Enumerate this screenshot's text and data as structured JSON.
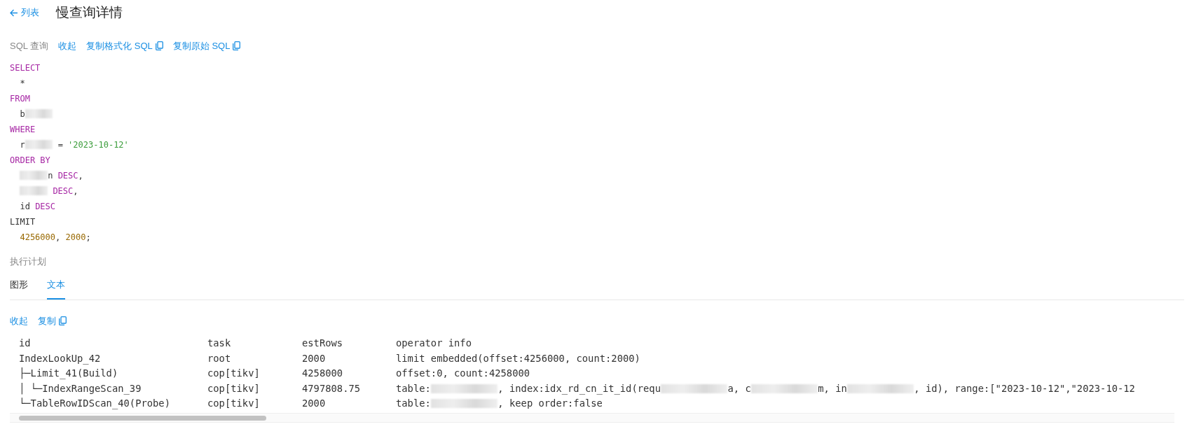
{
  "header": {
    "back_link": "列表",
    "title": "慢查询详情"
  },
  "sql_section": {
    "label": "SQL 查询",
    "actions": [
      {
        "label": "收起",
        "copy": false
      },
      {
        "label": "复制格式化 SQL",
        "copy": true
      },
      {
        "label": "复制原始 SQL",
        "copy": true
      }
    ],
    "lines": [
      [
        {
          "kind": "keyword",
          "text": "SELECT"
        }
      ],
      [
        {
          "kind": "plain",
          "text": "  *"
        }
      ],
      [
        {
          "kind": "keyword",
          "text": "FROM"
        }
      ],
      [
        {
          "kind": "plain",
          "text": "  b"
        },
        {
          "kind": "redacted"
        }
      ],
      [
        {
          "kind": "keyword",
          "text": "WHERE"
        }
      ],
      [
        {
          "kind": "plain",
          "text": "  r"
        },
        {
          "kind": "redacted"
        },
        {
          "kind": "plain",
          "text": " = "
        },
        {
          "kind": "string",
          "text": "'2023-10-12'"
        }
      ],
      [
        {
          "kind": "keyword",
          "text": "ORDER BY"
        }
      ],
      [
        {
          "kind": "indent"
        },
        {
          "kind": "redacted"
        },
        {
          "kind": "plain",
          "text": "n "
        },
        {
          "kind": "keyword",
          "text": "DESC"
        },
        {
          "kind": "plain",
          "text": ","
        }
      ],
      [
        {
          "kind": "indent"
        },
        {
          "kind": "redacted"
        },
        {
          "kind": "keyword",
          "text": " DESC"
        },
        {
          "kind": "plain",
          "text": ","
        }
      ],
      [
        {
          "kind": "plain",
          "text": "  id "
        },
        {
          "kind": "keyword",
          "text": "DESC"
        }
      ],
      [
        {
          "kind": "plain",
          "text": "LIMIT"
        }
      ],
      [
        {
          "kind": "indent"
        },
        {
          "kind": "number",
          "text": "4256000"
        },
        {
          "kind": "plain",
          "text": ", "
        },
        {
          "kind": "number",
          "text": "2000"
        },
        {
          "kind": "plain",
          "text": ";"
        }
      ]
    ]
  },
  "plan_section": {
    "label": "执行计划",
    "tabs": [
      {
        "label": "图形",
        "selected": false
      },
      {
        "label": "文本",
        "selected": true
      }
    ],
    "actions": [
      {
        "label": "收起",
        "copy": false
      },
      {
        "label": "复制",
        "copy": true
      }
    ],
    "columns": [
      "id",
      "task",
      "estRows",
      "operator info"
    ],
    "rows": [
      {
        "id": "IndexLookUp_42",
        "task": "root",
        "estRows": "2000",
        "info": [
          {
            "kind": "plain",
            "text": "limit embedded(offset:4256000, count:2000)"
          }
        ]
      },
      {
        "id": "├─Limit_41(Build)",
        "task": "cop[tikv]",
        "estRows": "4258000",
        "info": [
          {
            "kind": "plain",
            "text": "offset:0, count:4258000"
          }
        ]
      },
      {
        "id": "│ └─IndexRangeScan_39",
        "task": "cop[tikv]",
        "estRows": "4797808.75",
        "info": [
          {
            "kind": "plain",
            "text": "table:"
          },
          {
            "kind": "redacted"
          },
          {
            "kind": "plain",
            "text": ", index:idx_rd_cn_it_id(requ"
          },
          {
            "kind": "redacted"
          },
          {
            "kind": "plain",
            "text": "a, c"
          },
          {
            "kind": "redacted"
          },
          {
            "kind": "plain",
            "text": "m, in"
          },
          {
            "kind": "redacted"
          },
          {
            "kind": "plain",
            "text": ", id), range:[\"2023-10-12\",\"2023-10-12"
          }
        ]
      },
      {
        "id": "└─TableRowIDScan_40(Probe)",
        "task": "cop[tikv]",
        "estRows": "2000",
        "info": [
          {
            "kind": "plain",
            "text": "table:"
          },
          {
            "kind": "redacted"
          },
          {
            "kind": "plain",
            "text": ", keep order:false"
          }
        ]
      }
    ]
  }
}
